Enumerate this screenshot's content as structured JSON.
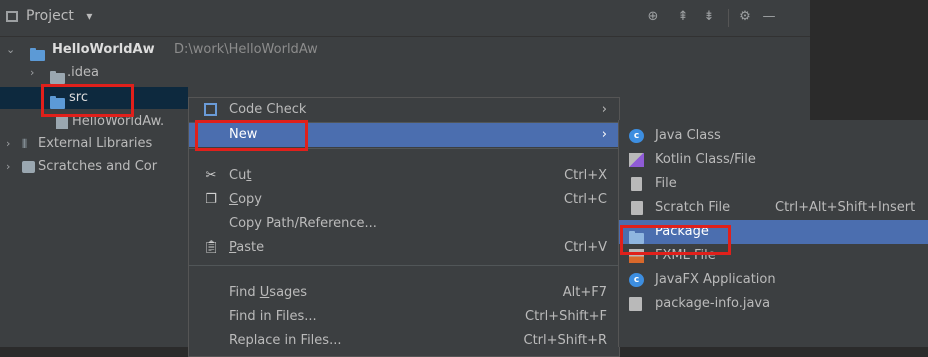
{
  "header": {
    "title": "Project",
    "dropdown": "▾"
  },
  "tree": {
    "project_name": "HelloWorldAw",
    "project_path": "D:\\work\\HelloWorldAw",
    "idea": ".idea",
    "src": "src",
    "file": "HelloWorldAw.",
    "external_libraries": "External Libraries",
    "scratches": "Scratches and Cor"
  },
  "context_menu": {
    "code_check": "Code Check",
    "new": "New",
    "cut_pre": "Cu",
    "cut_u": "t",
    "cut_sc": "Ctrl+X",
    "copy_u": "C",
    "copy_post": "opy",
    "copy_sc": "Ctrl+C",
    "copy_path": "Copy Path/Reference...",
    "paste_u": "P",
    "paste_post": "aste",
    "paste_sc": "Ctrl+V",
    "find_usages_pre": "Find ",
    "find_usages_u": "U",
    "find_usages_post": "sages",
    "find_usages_sc": "Alt+F7",
    "find_in_files": "Find in Files...",
    "find_in_files_sc": "Ctrl+Shift+F",
    "replace_in_files": "Replace in Files...",
    "replace_in_files_sc": "Ctrl+Shift+R"
  },
  "submenu": {
    "java_class": "Java Class",
    "kotlin_class": "Kotlin Class/File",
    "file": "File",
    "scratch_file": "Scratch File",
    "scratch_sc": "Ctrl+Alt+Shift+Insert",
    "package": "Package",
    "fxml_file": "FXML File",
    "javafx_app": "JavaFX Application",
    "package_info": "package-info.java"
  },
  "colors": {
    "highlight": "#4b6eaf",
    "annotation": "#e0201b",
    "panel": "#3c3f41"
  }
}
